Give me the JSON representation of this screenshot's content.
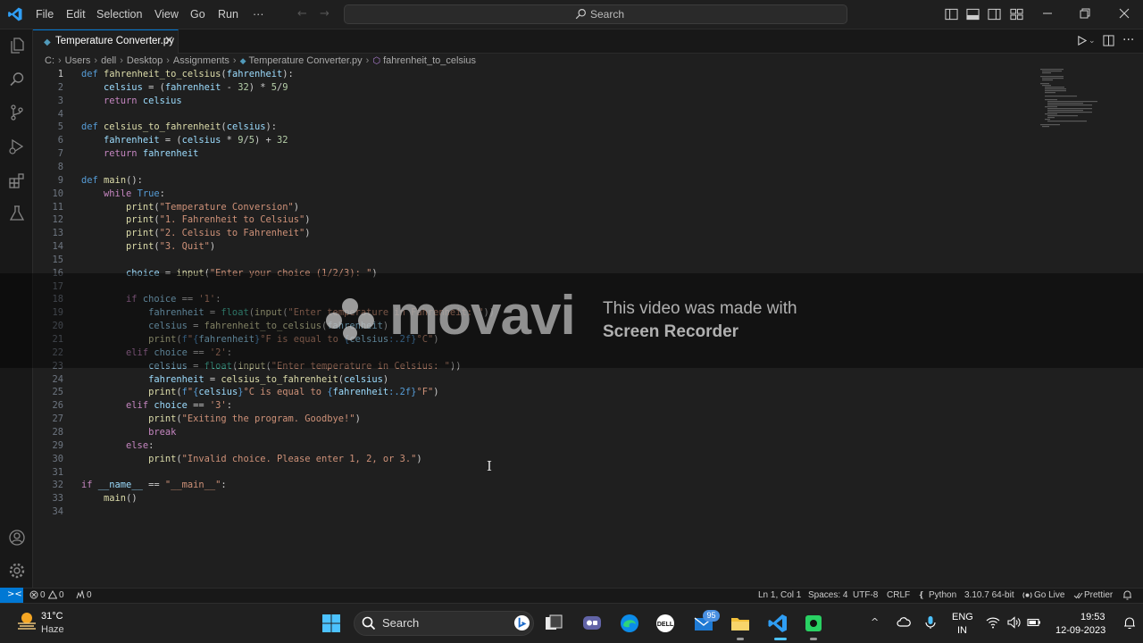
{
  "menu": [
    "File",
    "Edit",
    "Selection",
    "View",
    "Go",
    "Run",
    "···"
  ],
  "nav": {
    "back": "←",
    "forward": "→"
  },
  "command_center": {
    "label": "Search"
  },
  "tab": {
    "file_icon": "◆",
    "label": "Temperature Converter.py",
    "close": "×"
  },
  "editor_actions": {
    "run_chevron": "⌄",
    "more": "···"
  },
  "breadcrumb": [
    "C:",
    "Users",
    "dell",
    "Desktop",
    "Assignments",
    "Temperature Converter.py",
    "fahrenheit_to_celsius"
  ],
  "breadcrumb_sep": "›",
  "code_lines": [
    {
      "n": "1",
      "html": "<span class=\"kw\">def</span> <span class=\"fn\">fahrenheit_to_celsius</span>(<span class=\"var\">fahrenheit</span>):"
    },
    {
      "n": "2",
      "html": "    <span class=\"var\">celsius</span> = (<span class=\"var\">fahrenheit</span> - <span class=\"num\">32</span>) * <span class=\"num\">5</span>/<span class=\"num\">9</span>"
    },
    {
      "n": "3",
      "html": "    <span class=\"ctl\">return</span> <span class=\"var\">celsius</span>"
    },
    {
      "n": "4",
      "html": ""
    },
    {
      "n": "5",
      "html": "<span class=\"kw\">def</span> <span class=\"fn\">celsius_to_fahrenheit</span>(<span class=\"var\">celsius</span>):"
    },
    {
      "n": "6",
      "html": "    <span class=\"var\">fahrenheit</span> = (<span class=\"var\">celsius</span> * <span class=\"num\">9</span>/<span class=\"num\">5</span>) + <span class=\"num\">32</span>"
    },
    {
      "n": "7",
      "html": "    <span class=\"ctl\">return</span> <span class=\"var\">fahrenheit</span>"
    },
    {
      "n": "8",
      "html": ""
    },
    {
      "n": "9",
      "html": "<span class=\"kw\">def</span> <span class=\"fn\">main</span>():"
    },
    {
      "n": "10",
      "html": "    <span class=\"ctl\">while</span> <span class=\"kw\">True</span>:"
    },
    {
      "n": "11",
      "html": "        <span class=\"fn\">print</span>(<span class=\"str\">\"Temperature Conversion\"</span>)"
    },
    {
      "n": "12",
      "html": "        <span class=\"fn\">print</span>(<span class=\"str\">\"1. Fahrenheit to Celsius\"</span>)"
    },
    {
      "n": "13",
      "html": "        <span class=\"fn\">print</span>(<span class=\"str\">\"2. Celsius to Fahrenheit\"</span>)"
    },
    {
      "n": "14",
      "html": "        <span class=\"fn\">print</span>(<span class=\"str\">\"3. Quit\"</span>)"
    },
    {
      "n": "15",
      "html": ""
    },
    {
      "n": "16",
      "html": "        <span class=\"var\">choice</span> = <span class=\"fn\">input</span>(<span class=\"str\">\"Enter your choice (1/2/3): \"</span>)"
    },
    {
      "n": "17",
      "html": ""
    },
    {
      "n": "18",
      "html": "        <span class=\"ctl\">if</span> <span class=\"var\">choice</span> == <span class=\"str\">'1'</span>:"
    },
    {
      "n": "19",
      "html": "            <span class=\"var\">fahrenheit</span> = <span class=\"bi\">float</span>(<span class=\"fn\">input</span>(<span class=\"str\">\"Enter temperature in Fahrenheit: \"</span>))"
    },
    {
      "n": "20",
      "html": "            <span class=\"var\">celsius</span> = <span class=\"fn\">fahrenheit_to_celsius</span>(<span class=\"var\">fahrenheit</span>)"
    },
    {
      "n": "21",
      "html": "            <span class=\"fn\">print</span>(<span class=\"kw\">f</span><span class=\"str\">\"</span><span class=\"fmt\">{</span><span class=\"var\">fahrenheit</span><span class=\"fmt\">}</span><span class=\"str\">°F is equal to </span><span class=\"fmt\">{</span><span class=\"var\">celsius</span><span class=\"fmt\">:.2f}</span><span class=\"str\">°C\"</span>)"
    },
    {
      "n": "22",
      "html": "        <span class=\"ctl\">elif</span> <span class=\"var\">choice</span> == <span class=\"str\">'2'</span>:"
    },
    {
      "n": "23",
      "html": "            <span class=\"var\">celsius</span> = <span class=\"bi\">float</span>(<span class=\"fn\">input</span>(<span class=\"str\">\"Enter temperature in Celsius: \"</span>))"
    },
    {
      "n": "24",
      "html": "            <span class=\"var\">fahrenheit</span> = <span class=\"fn\">celsius_to_fahrenheit</span>(<span class=\"var\">celsius</span>)"
    },
    {
      "n": "25",
      "html": "            <span class=\"fn\">print</span>(<span class=\"kw\">f</span><span class=\"str\">\"</span><span class=\"fmt\">{</span><span class=\"var\">celsius</span><span class=\"fmt\">}</span><span class=\"str\">°C is equal to </span><span class=\"fmt\">{</span><span class=\"var\">fahrenheit</span><span class=\"fmt\">:.2f}</span><span class=\"str\">°F\"</span>)"
    },
    {
      "n": "26",
      "html": "        <span class=\"ctl\">elif</span> <span class=\"var\">choice</span> == <span class=\"str\">'3'</span>:"
    },
    {
      "n": "27",
      "html": "            <span class=\"fn\">print</span>(<span class=\"str\">\"Exiting the program. Goodbye!\"</span>)"
    },
    {
      "n": "28",
      "html": "            <span class=\"ctl\">break</span>"
    },
    {
      "n": "29",
      "html": "        <span class=\"ctl\">else</span>:"
    },
    {
      "n": "30",
      "html": "            <span class=\"fn\">print</span>(<span class=\"str\">\"Invalid choice. Please enter 1, 2, or 3.\"</span>)"
    },
    {
      "n": "31",
      "html": ""
    },
    {
      "n": "32",
      "html": "<span class=\"ctl\">if</span> <span class=\"var\">__name__</span> == <span class=\"str\">\"__main__\"</span>:"
    },
    {
      "n": "33",
      "html": "    <span class=\"fn\">main</span>()"
    },
    {
      "n": "34",
      "html": ""
    }
  ],
  "watermark": {
    "brand": "movavi",
    "line1": "This video was made with",
    "line2": "Screen Recorder"
  },
  "status": {
    "remote": "><",
    "errors": "0",
    "warnings": "0",
    "ports": "0",
    "position": "Ln 1, Col 1",
    "spaces": "Spaces: 4",
    "encoding": "UTF-8",
    "eol": "CRLF",
    "language": "Python",
    "interpreter": "3.10.7 64-bit",
    "golive": "Go Live",
    "prettier": "Prettier"
  },
  "taskbar": {
    "weather_temp": "31°C",
    "weather_desc": "Haze",
    "search_label": "Search",
    "mail_badge": "95",
    "tray_chevron": "^",
    "lang1": "ENG",
    "lang2": "IN",
    "time": "19:53",
    "date": "12-09-2023"
  },
  "colors": {
    "accent": "#0078d4",
    "bg": "#1f1f1f",
    "statusbar": "#181818"
  }
}
